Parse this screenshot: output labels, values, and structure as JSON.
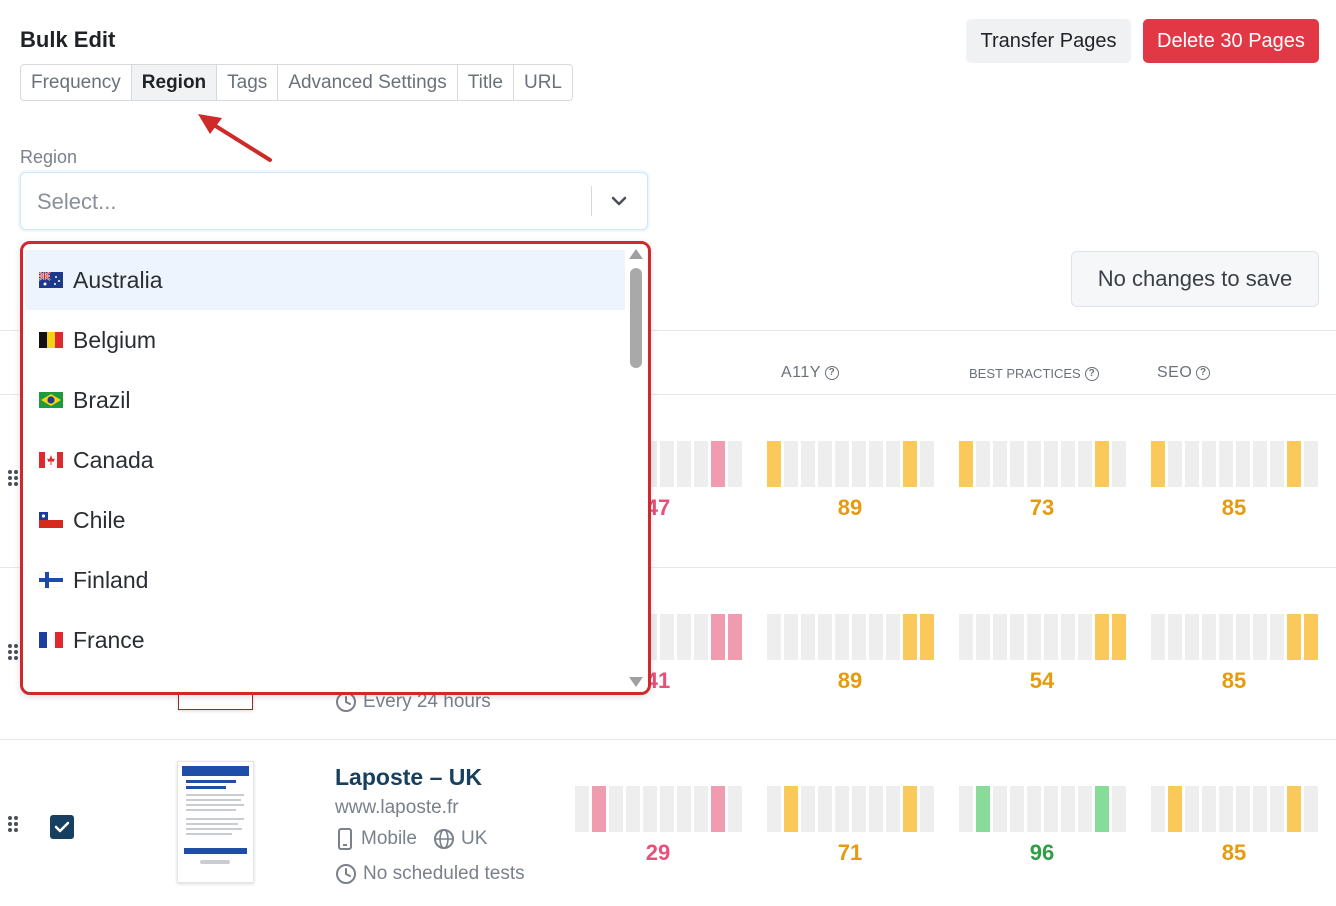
{
  "header": {
    "title": "Bulk Edit",
    "tabs": [
      {
        "label": "Frequency"
      },
      {
        "label": "Region"
      },
      {
        "label": "Tags"
      },
      {
        "label": "Advanced Settings"
      },
      {
        "label": "Title"
      },
      {
        "label": "URL"
      }
    ],
    "active_tab": "Region",
    "transfer_label": "Transfer Pages",
    "delete_label": "Delete 30 Pages"
  },
  "region_field": {
    "label": "Region",
    "placeholder": "Select..."
  },
  "save_label": "No changes to save",
  "dropdown": {
    "options": [
      {
        "label": "Australia",
        "flag": "australia-flag-icon"
      },
      {
        "label": "Belgium",
        "flag": "belgium-flag-icon"
      },
      {
        "label": "Brazil",
        "flag": "brazil-flag-icon"
      },
      {
        "label": "Canada",
        "flag": "canada-flag-icon"
      },
      {
        "label": "Chile",
        "flag": "chile-flag-icon"
      },
      {
        "label": "Finland",
        "flag": "finland-flag-icon"
      },
      {
        "label": "France",
        "flag": "france-flag-icon"
      }
    ],
    "highlighted": "Australia"
  },
  "columns": {
    "a11y": "A11Y",
    "best_practices": "BEST PRACTICES",
    "seo": "SEO"
  },
  "rows": [
    {
      "scores": {
        "performance": "47",
        "a11y": "89",
        "best_practices": "73",
        "seo": "85"
      }
    },
    {
      "frequency": "Every 24 hours",
      "scores": {
        "performance": "41",
        "a11y": "89",
        "best_practices": "54",
        "seo": "85"
      }
    },
    {
      "title": "Laposte – UK",
      "url": "www.laposte.fr",
      "device": "Mobile",
      "region": "UK",
      "frequency": "No scheduled tests",
      "checked": true,
      "scores": {
        "performance": "29",
        "a11y": "71",
        "best_practices": "96",
        "seo": "85"
      }
    }
  ],
  "colors": {
    "delete": "#e23846",
    "dropdown_border": "#d0282f",
    "score_pink": "#e8507a",
    "score_orange": "#e59b0d",
    "score_green": "#2f9e44"
  }
}
